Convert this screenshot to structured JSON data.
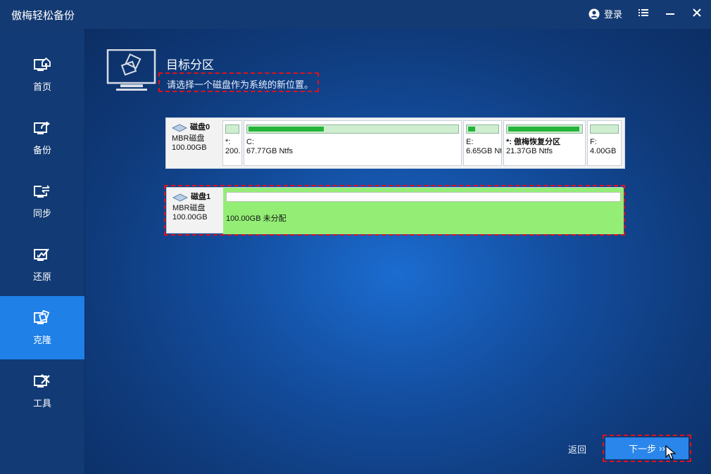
{
  "app": {
    "title": "傲梅轻松备份"
  },
  "titlebar": {
    "login_label": "登录",
    "menu_icon": "hamburger-menu-icon",
    "minimize_icon": "minimize-icon",
    "close_icon": "close-icon"
  },
  "sidebar": {
    "items": [
      {
        "label": "首页",
        "icon": "home-monitor-icon",
        "active": false
      },
      {
        "label": "备份",
        "icon": "backup-monitor-icon",
        "active": false
      },
      {
        "label": "同步",
        "icon": "sync-monitor-icon",
        "active": false
      },
      {
        "label": "还原",
        "icon": "restore-monitor-icon",
        "active": false
      },
      {
        "label": "克隆",
        "icon": "clone-monitor-icon",
        "active": true
      },
      {
        "label": "工具",
        "icon": "tools-monitor-icon",
        "active": false
      }
    ]
  },
  "main": {
    "title": "目标分区",
    "subtitle": "请选择一个磁盘作为系统的新位置。",
    "disks": [
      {
        "name": "磁盘0",
        "type": "MBR磁盘",
        "size": "100.00GB",
        "partitions": [
          {
            "label": "*:",
            "detail": "200.",
            "fill": 0.05
          },
          {
            "label": "C:",
            "detail": "67.77GB Ntfs",
            "fill": 0.37
          },
          {
            "label": "E:",
            "detail": "6.65GB Nt",
            "fill": 0.3
          },
          {
            "label": "*: 傲梅恢复分区",
            "detail": "21.37GB Ntfs",
            "fill": 0.98
          },
          {
            "label": "F:",
            "detail": "4.00GB",
            "fill": 0.05
          }
        ]
      },
      {
        "name": "磁盘1",
        "type": "MBR磁盘",
        "size": "100.00GB",
        "partitions": [
          {
            "label": "",
            "detail": "100.00GB 未分配",
            "fill": 0
          }
        ]
      }
    ]
  },
  "footer": {
    "back_label": "返回",
    "next_label": "下一步",
    "next_arrows": "››"
  },
  "colors": {
    "accent": "#1f80e8",
    "selection_outline": "#e3101b",
    "unallocated": "#94ee76",
    "used_bar": "#24b43a"
  }
}
